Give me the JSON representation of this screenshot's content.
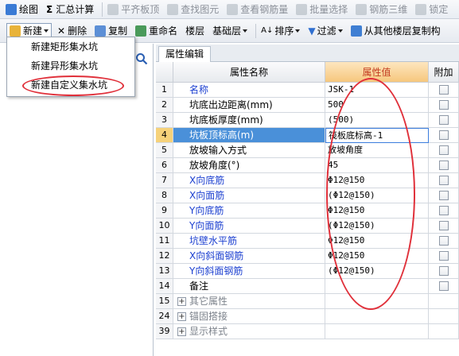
{
  "toolbar1": {
    "draw": "绘图",
    "summary": "汇总计算",
    "flush_slab_top": "平齐板顶",
    "find_element": "查找图元",
    "view_rebar_qty": "查看钢筋量",
    "batch_select": "批量选择",
    "rebar_3d": "钢筋三维",
    "lock": "锁定"
  },
  "toolbar2": {
    "new": "新建",
    "delete": "删除",
    "copy": "复制",
    "rename": "重命名",
    "floor": "楼层",
    "base_floor": "基础层",
    "sort": "排序",
    "filter": "过滤",
    "copy_from_floor": "从其他楼层复制构"
  },
  "new_menu": {
    "items": [
      "新建矩形集水坑",
      "新建异形集水坑",
      "新建自定义集水坑"
    ]
  },
  "panel": {
    "tab": "属性编辑",
    "headers": {
      "name": "属性名称",
      "value": "属性值",
      "extra": "附加"
    }
  },
  "rows": [
    {
      "num": "1",
      "name": "名称",
      "value": "JSK-1",
      "color": "blue"
    },
    {
      "num": "2",
      "name": "坑底出边距离(mm)",
      "value": "500",
      "color": "black"
    },
    {
      "num": "3",
      "name": "坑底板厚度(mm)",
      "value": "(500)",
      "color": "black"
    },
    {
      "num": "4",
      "name": "坑板顶标高(m)",
      "value": "筏板底标高-1",
      "color": "black"
    },
    {
      "num": "5",
      "name": "放坡输入方式",
      "value": "放坡角度",
      "color": "black"
    },
    {
      "num": "6",
      "name": "放坡角度(°)",
      "value": "45",
      "color": "black"
    },
    {
      "num": "7",
      "name": "X向底筋",
      "value": "Φ12@150",
      "color": "blue"
    },
    {
      "num": "8",
      "name": "X向面筋",
      "value": "(Φ12@150)",
      "color": "blue"
    },
    {
      "num": "9",
      "name": "Y向底筋",
      "value": "Φ12@150",
      "color": "blue"
    },
    {
      "num": "10",
      "name": "Y向面筋",
      "value": "(Φ12@150)",
      "color": "blue"
    },
    {
      "num": "11",
      "name": "坑壁水平筋",
      "value": "Φ12@150",
      "color": "blue"
    },
    {
      "num": "12",
      "name": "X向斜面钢筋",
      "value": "Φ12@150",
      "color": "blue"
    },
    {
      "num": "13",
      "name": "Y向斜面钢筋",
      "value": "(Φ12@150)",
      "color": "blue"
    },
    {
      "num": "14",
      "name": "备注",
      "value": "",
      "color": "black"
    }
  ],
  "groups": [
    {
      "num": "15",
      "name": "其它属性"
    },
    {
      "num": "24",
      "name": "锚固搭接"
    },
    {
      "num": "39",
      "name": "显示样式"
    }
  ],
  "colors": {
    "accent_red": "#e0303a",
    "link_blue": "#1b3fd0",
    "header_orange": "#f6c77d",
    "selection_blue": "#4a90d9"
  }
}
